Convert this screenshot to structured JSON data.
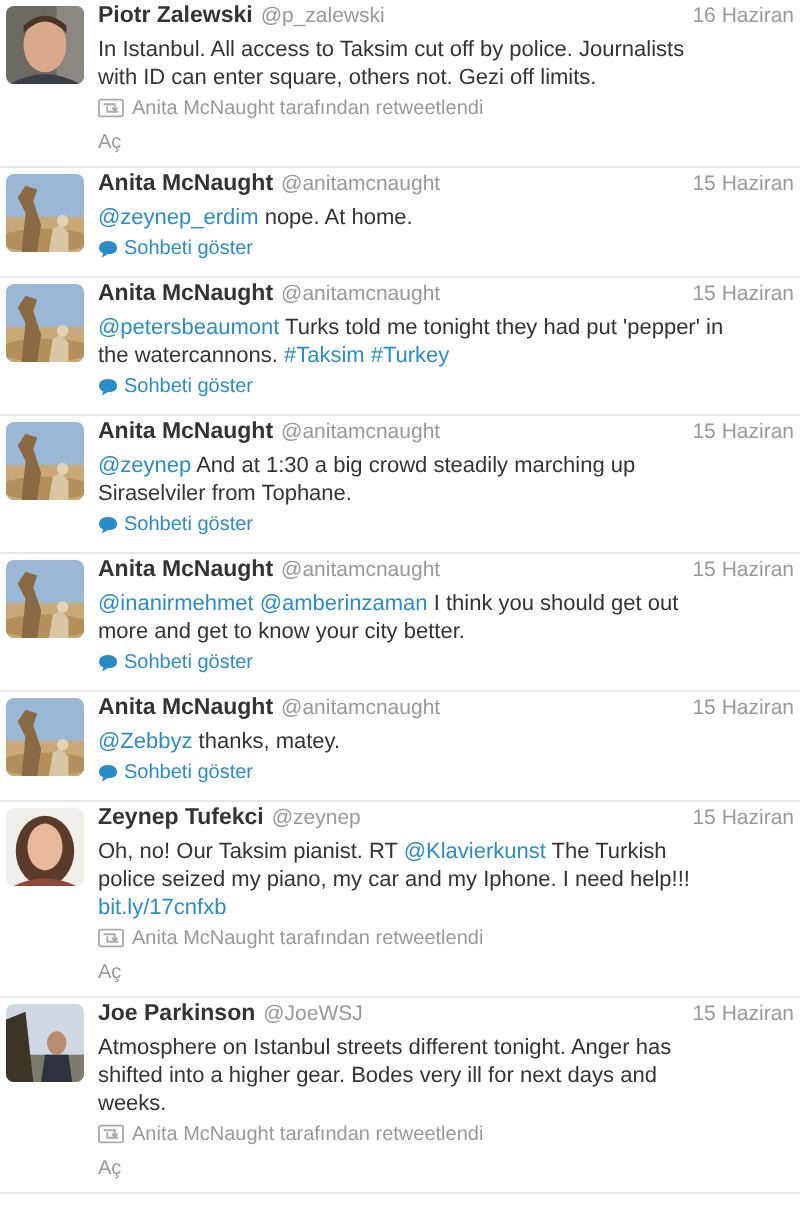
{
  "tweets": [
    {
      "name": "Piotr Zalewski",
      "handle": "@p_zalewski",
      "date": "16 Haziran",
      "avatar": {
        "kind": "picture"
      },
      "text": [
        {
          "kind": "plain",
          "text": "In Istanbul. All access to Taksim cut off by police. Journalists with ID can enter square, others not. Gezi off limits."
        }
      ],
      "footer": {
        "kind": "retweet",
        "label": "Anita McNaught tarafından retweetlendi",
        "action": "Aç"
      }
    },
    {
      "name": "Anita McNaught",
      "handle": "@anitamcnaught",
      "date": "15 Haziran",
      "avatar": {
        "kind": "picture"
      },
      "text": [
        {
          "kind": "link",
          "text": "@zeynep_erdim"
        },
        {
          "kind": "plain",
          "text": " nope. At home."
        }
      ],
      "footer": {
        "kind": "conversation",
        "label": "Sohbeti göster"
      }
    },
    {
      "name": "Anita McNaught",
      "handle": "@anitamcnaught",
      "date": "15 Haziran",
      "avatar": {
        "kind": "picture"
      },
      "text": [
        {
          "kind": "link",
          "text": "@petersbeaumont"
        },
        {
          "kind": "plain",
          "text": " Turks told me tonight they had put 'pepper' in the watercannons. "
        },
        {
          "kind": "link",
          "text": "#Taksim #Turkey"
        }
      ],
      "footer": {
        "kind": "conversation",
        "label": "Sohbeti göster"
      }
    },
    {
      "name": "Anita McNaught",
      "handle": "@anitamcnaught",
      "date": "15 Haziran",
      "avatar": {
        "kind": "picture"
      },
      "text": [
        {
          "kind": "link",
          "text": "@zeynep"
        },
        {
          "kind": "plain",
          "text": " And at 1:30 a big crowd steadily marching up Siraselviler from Tophane."
        }
      ],
      "footer": {
        "kind": "conversation",
        "label": "Sohbeti göster"
      }
    },
    {
      "name": "Anita McNaught",
      "handle": "@anitamcnaught",
      "date": "15 Haziran",
      "avatar": {
        "kind": "picture"
      },
      "text": [
        {
          "kind": "link",
          "text": "@inanirmehmet @amberinzaman"
        },
        {
          "kind": "plain",
          "text": " I think you should get out more and get to know your city better."
        }
      ],
      "footer": {
        "kind": "conversation",
        "label": "Sohbeti göster"
      }
    },
    {
      "name": "Anita McNaught",
      "handle": "@anitamcnaught",
      "date": "15 Haziran",
      "avatar": {
        "kind": "picture"
      },
      "text": [
        {
          "kind": "link",
          "text": "@Zebbyz"
        },
        {
          "kind": "plain",
          "text": " thanks, matey."
        }
      ],
      "footer": {
        "kind": "conversation",
        "label": "Sohbeti göster"
      }
    },
    {
      "name": "Zeynep Tufekci",
      "handle": "@zeynep",
      "date": "15 Haziran",
      "avatar": {
        "kind": "picture"
      },
      "text": [
        {
          "kind": "plain",
          "text": "Oh, no! Our Taksim pianist. RT "
        },
        {
          "kind": "link",
          "text": "@Klavierkunst"
        },
        {
          "kind": "plain",
          "text": " The Turkish police seized my piano, my car and my Iphone. I need help!!! "
        },
        {
          "kind": "link",
          "text": "bit.ly/17cnfxb"
        }
      ],
      "footer": {
        "kind": "retweet",
        "label": "Anita McNaught tarafından retweetlendi",
        "action": "Aç"
      }
    },
    {
      "name": "Joe Parkinson",
      "handle": "@JoeWSJ",
      "date": "15 Haziran",
      "avatar": {
        "kind": "picture"
      },
      "text": [
        {
          "kind": "plain",
          "text": "Atmosphere on Istanbul streets different tonight. Anger has shifted into a higher gear. Bodes very ill for next days and weeks."
        }
      ],
      "footer": {
        "kind": "retweet",
        "label": "Anita McNaught tarafından retweetlendi",
        "action": "Aç"
      }
    }
  ]
}
